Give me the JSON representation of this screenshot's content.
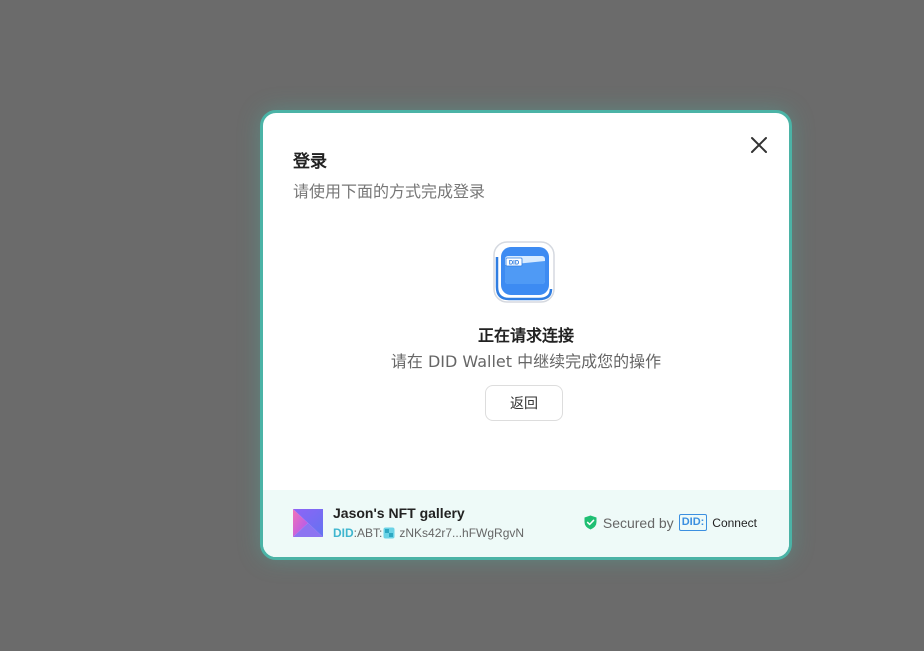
{
  "dialog": {
    "title": "登录",
    "subtitle": "请使用下面的方式完成登录",
    "close_icon": "close-icon"
  },
  "status": {
    "title": "正在请求连接",
    "message": "请在 DID Wallet 中继续完成您的操作",
    "wallet_icon": "did-wallet-icon",
    "wallet_icon_label": "DID"
  },
  "back_button": {
    "label": "返回"
  },
  "footer": {
    "app_name": "Jason's NFT gallery",
    "did_prefix": "DID",
    "abt_prefix": ":ABT:",
    "address": "zNKs42r7...hFWgRgvN",
    "secured_label": "Secured by",
    "did_badge": "DID:",
    "connect_label": "Connect"
  },
  "colors": {
    "accent_border": "#4bb3a6",
    "footer_bg": "#eefaf8",
    "shield": "#1fbf73",
    "did_blue": "#3b8fe0"
  }
}
